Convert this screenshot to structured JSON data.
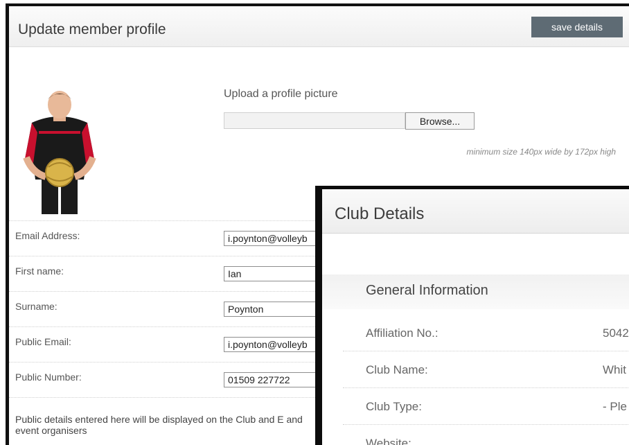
{
  "profile": {
    "title": "Update member profile",
    "save_label": "save details",
    "upload_label": "Upload a profile picture",
    "browse_label": "Browse...",
    "size_note": "minimum size 140px wide by 172px high",
    "fields": [
      {
        "label": "Email Address:",
        "value": "i.poynton@volleyb"
      },
      {
        "label": "First name:",
        "value": "Ian"
      },
      {
        "label": "Surname:",
        "value": "Poynton"
      },
      {
        "label": "Public Email:",
        "value": "i.poynton@volleyb"
      },
      {
        "label": "Public Number:",
        "value": "01509 227722"
      }
    ],
    "public_note": "Public details entered here will be displayed on the Club and E and event organisers"
  },
  "club": {
    "title": "Club Details",
    "section_title": "General Information",
    "rows": [
      {
        "label": "Affiliation No.:",
        "value": "5042"
      },
      {
        "label": "Club Name:",
        "value": "Whit"
      },
      {
        "label": "Club Type:",
        "value": "- Ple"
      },
      {
        "label": "Website:",
        "value": ""
      }
    ]
  },
  "colors": {
    "save_button": "#5e6b74",
    "panel_border": "#111111"
  }
}
